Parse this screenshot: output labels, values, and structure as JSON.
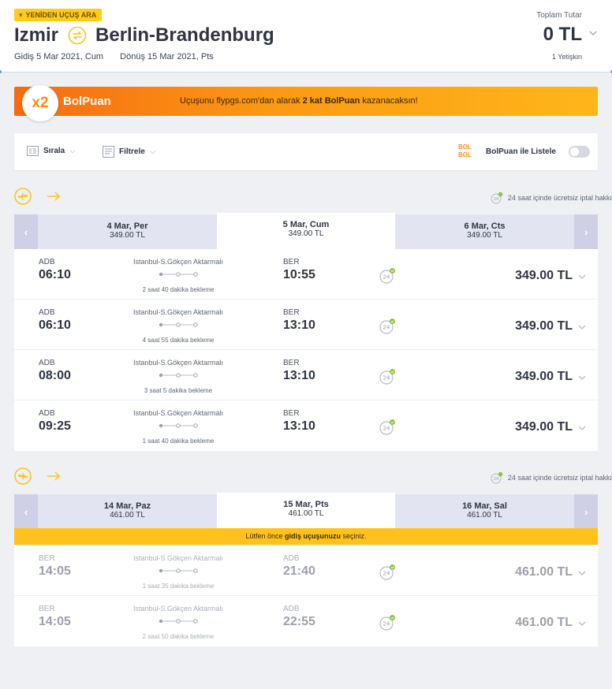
{
  "header": {
    "again_badge": "YENİDEN UÇUŞ ARA",
    "origin": "Izmir",
    "destination": "Berlin-Brandenburg",
    "departure_date": "Gidiş 5 Mar 2021, Cum",
    "return_date": "Dönüş 15 Mar 2021, Pts",
    "total_label": "Toplam Tutar",
    "total_value": "0 TL",
    "passengers": "1 Yetişkin"
  },
  "promo": {
    "multiplier": "x2",
    "name": "BolPuan",
    "text_before": "Uçuşunu flypgs.com'dan alarak ",
    "text_bold": "2 kat BolPuan",
    "text_after": " kazanacaksın!"
  },
  "toolbar": {
    "sort_label": "Sırala",
    "filter_label": "Filtrele",
    "bolpuan_logo": "BOL BOL",
    "bolpuan_list_label": "BolPuan ile Listele"
  },
  "cancel_note": "24 saat içinde ücretsiz iptal hakkı",
  "outbound": {
    "days": [
      {
        "date": "4 Mar, Per",
        "price": "349.00 TL"
      },
      {
        "date": "5 Mar, Cum",
        "price": "349.00 TL"
      },
      {
        "date": "6 Mar, Cts",
        "price": "349.00 TL"
      }
    ],
    "flights": [
      {
        "dep_code": "ADB",
        "dep_time": "06:10",
        "via": "Istanbul-S.Gökçen Aktarmalı",
        "wait": "2 saat 40 dakika bekleme",
        "arr_code": "BER",
        "arr_time": "10:55",
        "price": "349.00 TL"
      },
      {
        "dep_code": "ADB",
        "dep_time": "06:10",
        "via": "Istanbul-S.Gökçen Aktarmalı",
        "wait": "4 saat 55 dakika bekleme",
        "arr_code": "BER",
        "arr_time": "13:10",
        "price": "349.00 TL"
      },
      {
        "dep_code": "ADB",
        "dep_time": "08:00",
        "via": "Istanbul-S.Gökçen Aktarmalı",
        "wait": "3 saat 5 dakika bekleme",
        "arr_code": "BER",
        "arr_time": "13:10",
        "price": "349.00 TL"
      },
      {
        "dep_code": "ADB",
        "dep_time": "09:25",
        "via": "Istanbul-S.Gökçen Aktarmalı",
        "wait": "1 saat 40 dakika bekleme",
        "arr_code": "BER",
        "arr_time": "13:10",
        "price": "349.00 TL"
      }
    ]
  },
  "return": {
    "days": [
      {
        "date": "14 Mar, Paz",
        "price": "461.00 TL"
      },
      {
        "date": "15 Mar, Pts",
        "price": "461.00 TL"
      },
      {
        "date": "16 Mar, Sal",
        "price": "461.00 TL"
      }
    ],
    "warning_before": "Lütfen önce ",
    "warning_bold": "gidiş uçuşunuzu",
    "warning_after": " seçiniz.",
    "flights": [
      {
        "dep_code": "BER",
        "dep_time": "14:05",
        "via": "Istanbul-S.Gökçen Aktarmalı",
        "wait": "1 saat 35 dakika bekleme",
        "arr_code": "ADB",
        "arr_time": "21:40",
        "price": "461.00 TL"
      },
      {
        "dep_code": "BER",
        "dep_time": "14:05",
        "via": "Istanbul-S.Gökçen Aktarmalı",
        "wait": "2 saat 50 dakika bekleme",
        "arr_code": "ADB",
        "arr_time": "22:55",
        "price": "461.00 TL"
      }
    ]
  },
  "colors": {
    "accent_yellow": "#ffc21c",
    "promo_orange": "#f56b12",
    "nav_lavender": "#cfd0e6",
    "tab_inactive": "#e3e4f1",
    "check_green": "#8cc63f"
  },
  "icons": [
    "chevron-down-icon",
    "swap-icon",
    "plane-takeoff-icon",
    "plane-landing-icon",
    "arrow-right-icon",
    "free-cancel-24-icon",
    "sort-icon",
    "filter-icon",
    "toggle-switch"
  ]
}
